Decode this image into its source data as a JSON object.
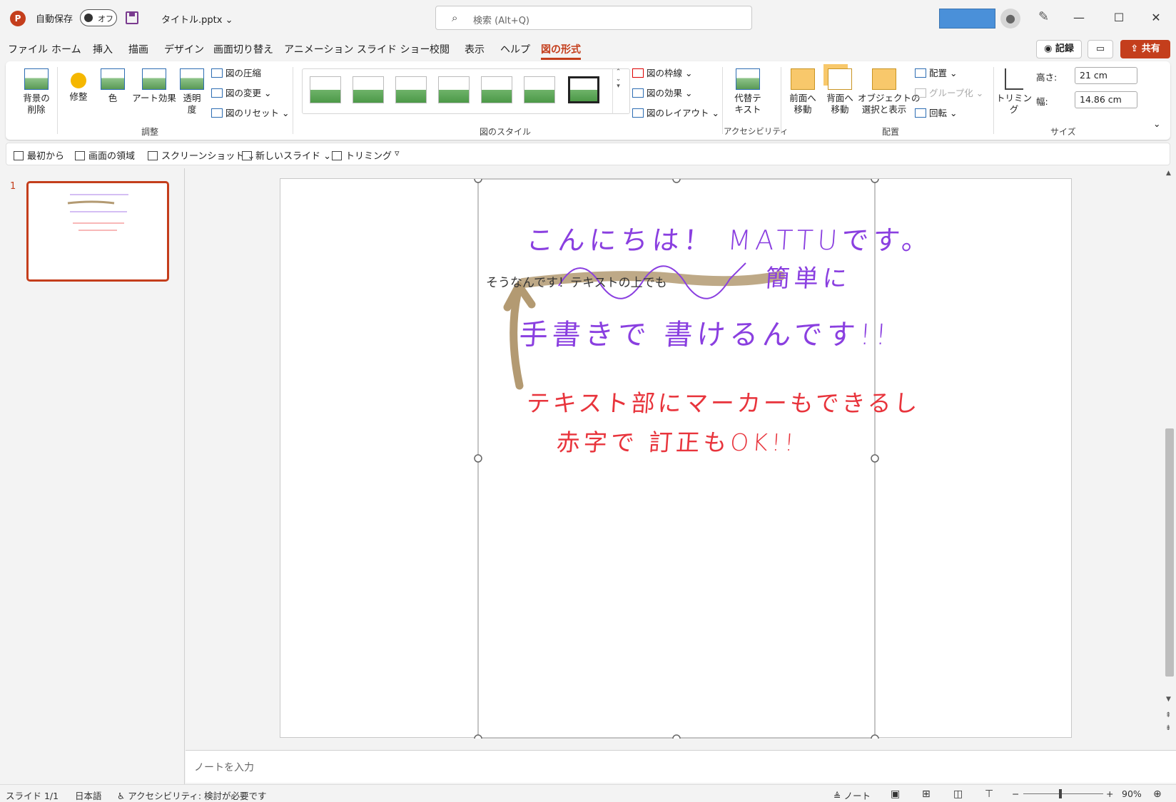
{
  "app": {
    "logo": "P",
    "autosave_label": "自動保存",
    "autosave_state": "オフ",
    "filename": "タイトル.pptx",
    "caret": "⌄"
  },
  "search": {
    "icon": "⌕",
    "placeholder": "検索 (Alt+Q)"
  },
  "window": {
    "minimize": "—",
    "maximize": "☐",
    "close": "✕"
  },
  "menu": [
    "ファイル",
    "ホーム",
    "挿入",
    "描画",
    "デザイン",
    "画面切り替え",
    "アニメーション",
    "スライド ショー",
    "校閲",
    "表示",
    "ヘルプ",
    "図の形式"
  ],
  "actions": {
    "record": "◉ 記録",
    "comment": "▭",
    "share": "⇪ 共有"
  },
  "ribbon": {
    "adjust": {
      "remove_bg": "背景の\n削除",
      "corrections": "修整",
      "color": "色",
      "artistic": "アート効果",
      "transparency": "透明\n度",
      "compress": "図の圧縮",
      "change": "図の変更",
      "reset": "図のリセット",
      "label": "調整"
    },
    "styles": {
      "label": "図のスタイル",
      "border": "図の枠線",
      "effects": "図の効果",
      "layout": "図のレイアウト"
    },
    "accessibility": {
      "alt_text": "代替テ\nキスト",
      "label": "アクセシビリティ"
    },
    "arrange": {
      "forward": "前面へ\n移動",
      "backward": "背面へ\n移動",
      "selection": "オブジェクトの\n選択と表示",
      "align": "配置",
      "group": "グループ化",
      "rotate": "回転",
      "label": "配置"
    },
    "size": {
      "crop": "トリミング",
      "height_label": "高さ:",
      "height": "21 cm",
      "width_label": "幅:",
      "width": "14.86 cm",
      "label": "サイズ"
    }
  },
  "qat": {
    "from_start": "最初から",
    "screen_clip": "画面の領域",
    "screenshot": "スクリーンショット",
    "new_slide": "新しいスライド",
    "trim": "トリミング"
  },
  "slides": {
    "number": "1"
  },
  "slide": {
    "typed_text": "そうなんです！テキストの上でも",
    "hand_line1": "こんにちは！ MATTUです。",
    "hand_line2": "簡単に",
    "hand_line3": "手書きで 書けるんです!!",
    "hand_line4": "テキスト部にマーカーもできるし",
    "hand_line5": "赤字で 訂正もOK!!",
    "colors": {
      "purple": "#8a3fe0",
      "red": "#e8343c",
      "marker": "#b39a72"
    }
  },
  "notes": {
    "placeholder": "ノートを入力"
  },
  "status": {
    "slide": "スライド 1/1",
    "language": "日本語",
    "accessibility": "アクセシビリティ: 検討が必要です",
    "notes": "≜ ノート",
    "zoom_minus": "−",
    "zoom_plus": "+",
    "zoom": "90%"
  }
}
